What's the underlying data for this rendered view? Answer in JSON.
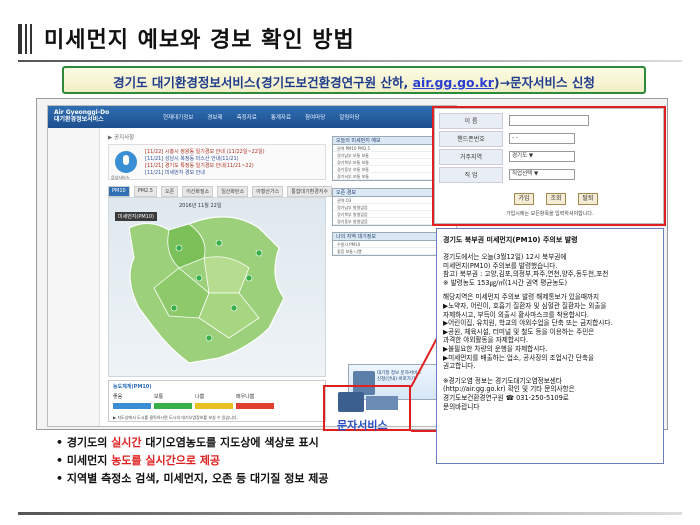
{
  "header": {
    "title": "미세먼지 예보와 경보 확인 방법"
  },
  "banner": {
    "text_before": "경기도 대기환경정보서비스(경기도보건환경연구원 산하, ",
    "link": "air.gg.go.kr",
    "text_after": ")→문자서비스 신청"
  },
  "site": {
    "logo_line1": "Air Gyeonggi-Do",
    "logo_line2": "대기환경정보서비스",
    "nav": [
      "현재대기정보",
      "경보제",
      "측정자료",
      "통계자료",
      "참여마당",
      "알림마당"
    ],
    "crumb": "▶ 공지사항",
    "notice_lines": [
      "[11/22] 시흥시 정왕동 일기경보 안내 (11/22일~22일)",
      "[11/21] 성남시 복정동 미스산 안내(11/21)",
      "[11/21] 경기도 특정동 일기경보 안내(11/21~22)",
      "[11/21] 미세먼지 경보 안내"
    ],
    "mic_label": "음성서비스",
    "tabs": [
      "PM10",
      "PM2.5",
      "오존",
      "이산화질소",
      "일산화탄소",
      "아황산가스",
      "통합대기환경지수"
    ],
    "map_date": "2016년 11월 22일",
    "map_tag": "미세먼지(PM10)",
    "legend_title": "농도체계(PM10)",
    "legend_labels": [
      "좋음",
      "보통",
      "나쁨",
      "매우나쁨"
    ],
    "legend_colors": [
      "#3a8fd4",
      "#38b04a",
      "#e8c020",
      "#e04030"
    ],
    "legend_note": "▶ 지도상에서 도시를 클릭하시면 도시의 대기오염정보를 보실 수 있습니다.",
    "panel1_head": "오늘의 미세먼지 예보",
    "panel1_lines": [
      "권역  PM10  PM2.5",
      "경기남부  보통  보통",
      "경기북부  보통  보통",
      "경기동부  보통  보통",
      "경기서부  보통  보통"
    ],
    "panel2_head": "오존 경보",
    "panel2_lines": [
      "권역  O3",
      "경기남부  발령없음",
      "경기북부  발령없음",
      "경기동부  발령없음"
    ],
    "panel3_head": "나의 지역 대기정보",
    "panel3_lines": [
      "수원시  PM10",
      "좋음  보통  나쁨"
    ],
    "sms_thumb_text": [
      "대기질 정보 문자서비스",
      "신청(안내) 바로가기"
    ],
    "sms_label": "문자서비스"
  },
  "form": {
    "rows": [
      {
        "label": "이 름",
        "value": ""
      },
      {
        "label": "핸드폰번호",
        "value": "-      -"
      },
      {
        "label": "거주지역",
        "value": "경기도 ▼"
      },
      {
        "label": "직 업",
        "value": "직업선택 ▼"
      }
    ],
    "buttons": [
      "가입",
      "조회",
      "탈퇴"
    ],
    "note": "가입시에는 모든항목을 입력하셔야합니다."
  },
  "alert": {
    "title": "경기도 북부권 미세먼지(PM10) 주의보 발령",
    "para1": [
      "경기도에서는 오늘(3월12일) 12시 북부권에",
      "미세먼지(PM10) 주의보를 발령했습니다.",
      "참고) 북부권 : 고양,김포,의정부,파주,연천,양주,동두천,포천",
      "※ 발령농도 153㎍/㎥(1시간 권역 평균농도)"
    ],
    "para2": [
      "해당지역은 미세먼지 주의보 발령 해제통보가 있을때까지",
      "▶노약자, 어린이, 호흡기 질환자 및 심혈관 질환자는 외출을",
      "   자제하시고, 부득이 외출시 황사마스크를 착용합시다.",
      "▶어린이집, 유치원, 학교의 야외수업을 단축 또는 금지합시다.",
      "▶공원, 체육시설, 터미널 및 철도 등을 이용하는 주민은",
      "   과격한 야외활동을 자제합시다.",
      "▶불필요한 차량의 운행을 자제합시다.",
      "▶미세먼지를 배출하는 업소, 공사장의 조업시간 단축을",
      "   권고합니다."
    ],
    "para3": [
      "※경기오염 정보는 경기도대기오염정보센타",
      "  (http://air.gg.go.kr) 확인 및 기타 문의사항은",
      "  경기도보건환경연구원 ☎ 031-250-5109로",
      "  문의바랍니다"
    ]
  },
  "bullets": [
    {
      "pre": "경기도의 ",
      "red": "실시간",
      "post": " 대기오염농도를 지도상에 색상로 표시"
    },
    {
      "pre": "미세먼지 ",
      "red": "농도를 실시간으로 제공",
      "post": ""
    },
    {
      "pre": "지역별 측정소 검색, 미세먼지, 오존 등 대기질 정보 제공",
      "red": "",
      "post": ""
    }
  ],
  "accent_colors": {
    "red": "#e02020",
    "blue": "#2a4fc0",
    "green": "#2c8a3a"
  }
}
